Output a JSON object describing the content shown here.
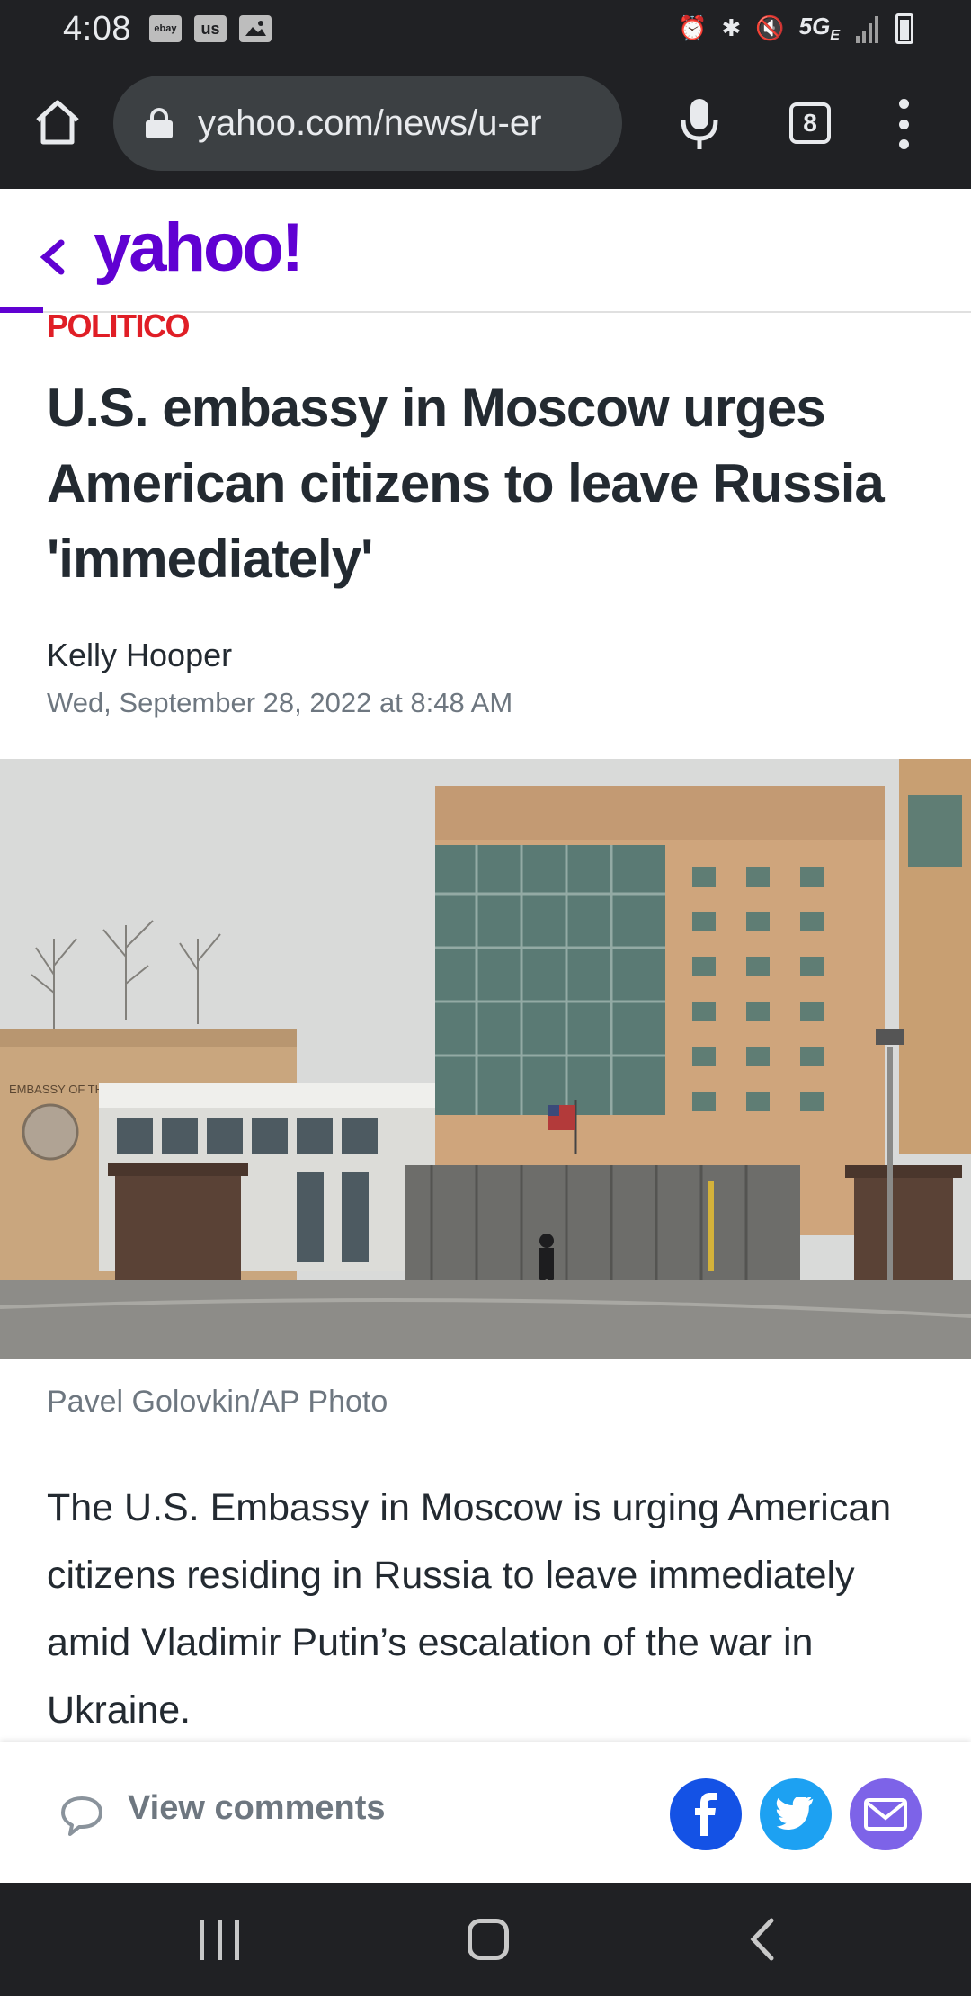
{
  "status_bar": {
    "time": "4:08",
    "notif_icons": [
      "ebay",
      "us",
      "image-icon"
    ],
    "network": "5G",
    "network_sub": "E"
  },
  "browser": {
    "url": "yahoo.com/news/u-er",
    "tab_count": "8"
  },
  "header": {
    "logo": "yahoo!"
  },
  "article": {
    "source": "POLITICO",
    "headline": "U.S. embassy in Moscow urges American citizens to leave Russia 'immediately'",
    "author": "Kelly Hooper",
    "date": "Wed, September 28, 2022 at 8:48 AM",
    "photo_caption": "Pavel Golovkin/AP Photo",
    "body": "The U.S. Embassy in Moscow is urging American citizens residing in Russia to leave immediately amid Vladimir Putin’s escalation of the war in Ukraine.",
    "building_sign": "EMBASSY OF THE UNITED STATES OF AMERICA"
  },
  "action_bar": {
    "view_comments": "View comments"
  },
  "colors": {
    "yahoo_purple": "#6001d2",
    "politico_red": "#e01e26",
    "facebook": "#1452e5",
    "twitter": "#1da1f2",
    "mail": "#7d63e8"
  }
}
